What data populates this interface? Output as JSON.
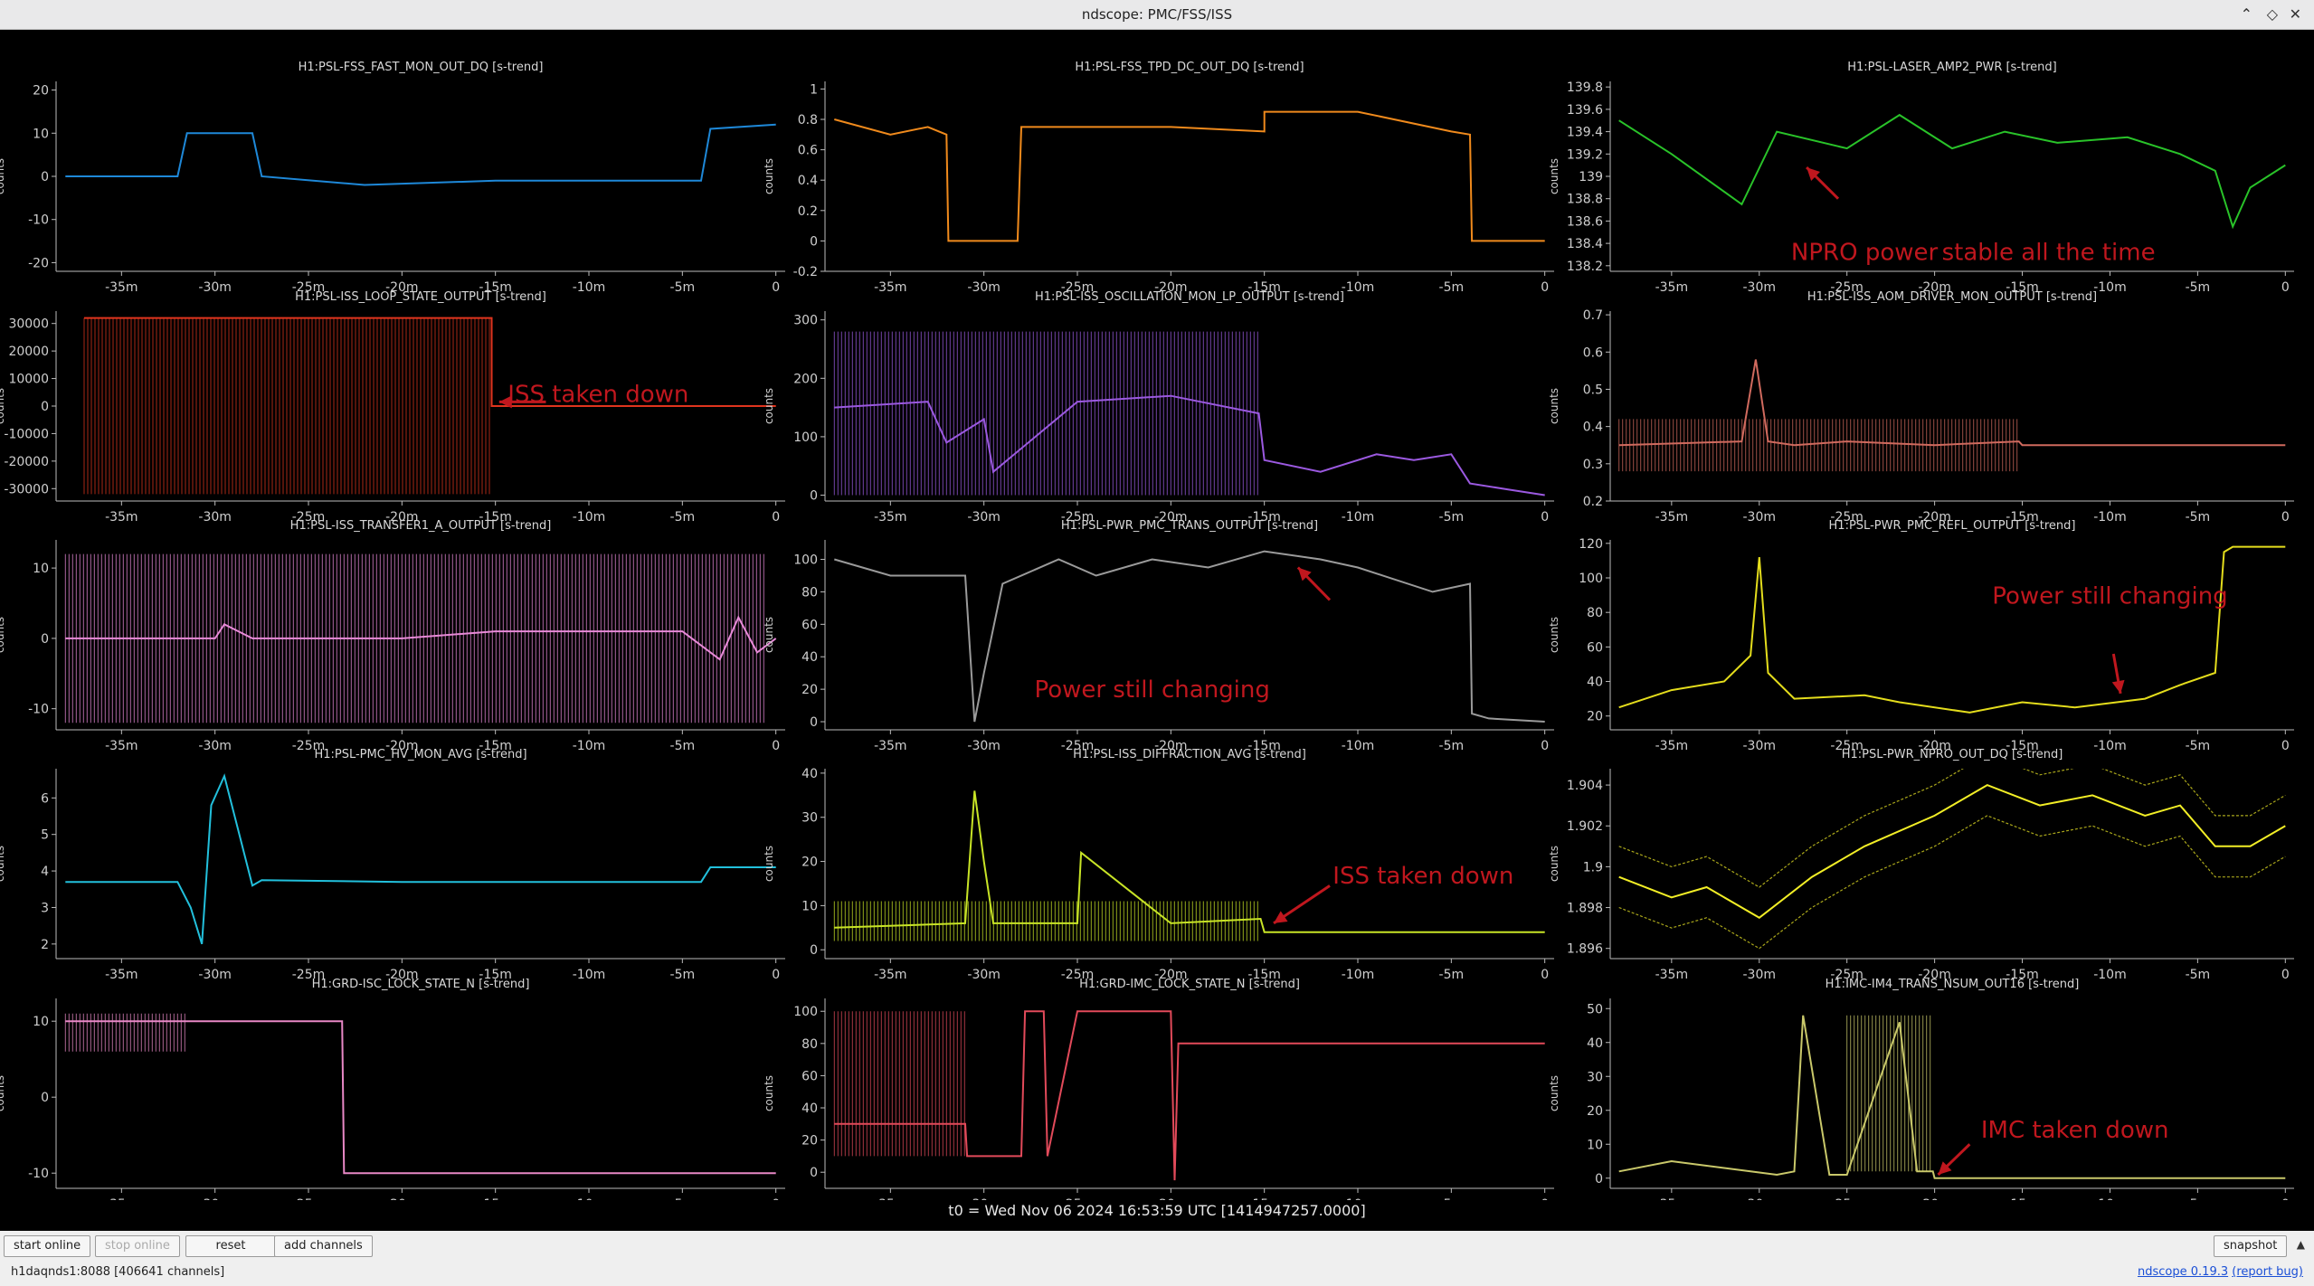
{
  "window": {
    "title": "ndscope: PMC/FSS/ISS"
  },
  "footer": {
    "t0_label": "t0 = Wed Nov 06 2024 16:53:59 UTC [1414947257.0000]",
    "start_online": "start online",
    "stop_online": "stop online",
    "reset": "reset",
    "add_channels": "add channels",
    "snapshot": "snapshot",
    "status": "h1daqnds1:8088  [406641 channels]",
    "version": "ndscope 0.19.3",
    "report_bug": "(report bug)"
  },
  "colors": {
    "annotation": "#c0171e",
    "background": "#000000",
    "axis": "#bbbbbb"
  },
  "chart_data": [
    {
      "type": "line",
      "title": "H1:PSL-FSS_FAST_MON_OUT_DQ [s-trend]",
      "ylabel": "counts",
      "color": "#1e88d8",
      "ylim": [
        -22,
        22
      ],
      "yticks": [
        -20,
        -10,
        0,
        10,
        20
      ],
      "x": [
        -38,
        -32,
        -31.5,
        -28,
        -27.5,
        -22,
        -15,
        -10,
        -4,
        -3.5,
        0
      ],
      "y": [
        0,
        0,
        10,
        10,
        0,
        -2,
        -1,
        -1,
        -1,
        11,
        12
      ],
      "annotations": []
    },
    {
      "type": "line",
      "title": "H1:PSL-FSS_TPD_DC_OUT_DQ [s-trend]",
      "ylabel": "counts",
      "color": "#f08a1c",
      "ylim": [
        -0.2,
        1.05
      ],
      "yticks": [
        -0.2,
        0,
        0.2,
        0.4,
        0.6,
        0.8,
        1
      ],
      "x": [
        -38,
        -35,
        -33,
        -32,
        -31.9,
        -28.2,
        -28,
        -25,
        -20,
        -15,
        -15,
        -10,
        -5,
        -4,
        -3.9,
        0
      ],
      "y": [
        0.8,
        0.7,
        0.75,
        0.7,
        0,
        0,
        0.75,
        0.75,
        0.75,
        0.72,
        0.85,
        0.85,
        0.72,
        0.7,
        0,
        0
      ],
      "annotations": []
    },
    {
      "type": "line",
      "title": "H1:PSL-LASER_AMP2_PWR [s-trend]",
      "ylabel": "counts",
      "color": "#29c329",
      "ylim": [
        138.15,
        139.85
      ],
      "yticks": [
        138.2,
        138.4,
        138.6,
        138.8,
        139,
        139.2,
        139.4,
        139.6,
        139.8
      ],
      "x": [
        -38,
        -35,
        -31,
        -29,
        -25,
        -22,
        -19,
        -16,
        -13,
        -9,
        -6,
        -4,
        -3,
        -2,
        0
      ],
      "y": [
        139.5,
        139.2,
        138.75,
        139.4,
        139.25,
        139.55,
        139.25,
        139.4,
        139.3,
        139.35,
        139.2,
        139.05,
        138.55,
        138.9,
        139.1
      ],
      "annotations": [
        {
          "text": "NPRO power",
          "x": -24,
          "y": 138.25
        },
        {
          "text": "stable all the time",
          "x": -13.5,
          "y": 138.25
        }
      ],
      "arrows": [
        {
          "x1": -25.5,
          "y1": 138.8,
          "x2": -27.3,
          "y2": 139.08
        }
      ]
    },
    {
      "type": "line",
      "title": "H1:PSL-ISS_LOOP_STATE_OUTPUT [s-trend]",
      "ylabel": "counts",
      "color": "#e0341e",
      "ylim": [
        -34500,
        34500
      ],
      "yticks": [
        -30000,
        -20000,
        -10000,
        0,
        10000,
        20000,
        30000
      ],
      "x": [
        -37,
        -15.2,
        -15.2,
        0
      ],
      "y": [
        32000,
        32000,
        0,
        0
      ],
      "band": [
        -37,
        -15.2,
        -32000,
        32000
      ],
      "annotations": [
        {
          "text": "ISS taken down",
          "x": -9.5,
          "y": 1500
        }
      ],
      "arrows": [
        {
          "x1": -12.3,
          "y1": 1500,
          "x2": -14.8,
          "y2": 1500
        }
      ]
    },
    {
      "type": "line",
      "title": "H1:PSL-ISS_OSCILLATION_MON_LP_OUTPUT [s-trend]",
      "ylabel": "counts",
      "color": "#9b59e0",
      "ylim": [
        -10,
        315
      ],
      "yticks": [
        0,
        100,
        200,
        300
      ],
      "x": [
        -38,
        -33,
        -32,
        -30,
        -29.5,
        -25,
        -20,
        -15.3,
        -15,
        -12,
        -9,
        -7,
        -5,
        -4,
        -2,
        0
      ],
      "y": [
        150,
        160,
        90,
        130,
        40,
        160,
        170,
        140,
        60,
        40,
        70,
        60,
        70,
        20,
        10,
        0
      ],
      "band": [
        -38,
        -15.3,
        0,
        280
      ],
      "annotations": []
    },
    {
      "type": "line",
      "title": "H1:PSL-ISS_AOM_DRIVER_MON_OUTPUT [s-trend]",
      "ylabel": "counts",
      "color": "#d06a5e",
      "ylim": [
        0.2,
        0.71
      ],
      "yticks": [
        0.2,
        0.3,
        0.4,
        0.5,
        0.6,
        0.7
      ],
      "x": [
        -38,
        -31,
        -30.2,
        -29.5,
        -28,
        -25,
        -20,
        -15.2,
        -15,
        0
      ],
      "y": [
        0.35,
        0.36,
        0.58,
        0.36,
        0.35,
        0.36,
        0.35,
        0.36,
        0.35,
        0.35
      ],
      "band": [
        -38,
        -15.2,
        0.28,
        0.42
      ],
      "annotations": []
    },
    {
      "type": "line",
      "title": "H1:PSL-ISS_TRANSFER1_A_OUTPUT [s-trend]",
      "ylabel": "counts",
      "color": "#e88ad8",
      "ylim": [
        -13,
        14
      ],
      "yticks": [
        -10,
        0,
        10
      ],
      "x": [
        -38,
        -30,
        -29.5,
        -28,
        -20,
        -15,
        -10,
        -5,
        -3,
        -2,
        -1,
        0
      ],
      "y": [
        0,
        0,
        2,
        0,
        0,
        1,
        1,
        1,
        -3,
        3,
        -2,
        0
      ],
      "band": [
        -38,
        -0.5,
        -12,
        12
      ],
      "annotations": []
    },
    {
      "type": "line",
      "title": "H1:PSL-PWR_PMC_TRANS_OUTPUT [s-trend]",
      "ylabel": "counts",
      "color": "#9a9a9a",
      "ylim": [
        -5,
        112
      ],
      "yticks": [
        0,
        20,
        40,
        60,
        80,
        100
      ],
      "x": [
        -38,
        -35,
        -31,
        -30.5,
        -30,
        -29,
        -26,
        -24,
        -21,
        -18,
        -15,
        -12,
        -10,
        -6,
        -4,
        -3.9,
        -3,
        0
      ],
      "y": [
        100,
        90,
        90,
        0,
        30,
        85,
        100,
        90,
        100,
        95,
        105,
        100,
        95,
        80,
        85,
        5,
        2,
        0
      ],
      "annotations": [
        {
          "text": "Power still changing",
          "x": -21,
          "y": 15
        }
      ],
      "arrows": [
        {
          "x1": -11.5,
          "y1": 75,
          "x2": -13.2,
          "y2": 95
        }
      ]
    },
    {
      "type": "line",
      "title": "H1:PSL-PWR_PMC_REFL_OUTPUT [s-trend]",
      "ylabel": "counts",
      "color": "#e4dd1c",
      "ylim": [
        12,
        122
      ],
      "yticks": [
        20,
        40,
        60,
        80,
        100,
        120
      ],
      "x": [
        -38,
        -35,
        -32,
        -30.5,
        -30,
        -29.5,
        -28,
        -24,
        -22,
        -18,
        -15,
        -12,
        -8,
        -6,
        -4,
        -3.5,
        -3,
        0
      ],
      "y": [
        25,
        35,
        40,
        55,
        112,
        45,
        30,
        32,
        28,
        22,
        28,
        25,
        30,
        38,
        45,
        115,
        118,
        118
      ],
      "annotations": [
        {
          "text": "Power still changing",
          "x": -10,
          "y": 85
        }
      ],
      "arrows": [
        {
          "x1": -9.8,
          "y1": 56,
          "x2": -9.4,
          "y2": 33
        }
      ]
    },
    {
      "type": "line",
      "title": "H1:PSL-PMC_HV_MON_AVG [s-trend]",
      "ylabel": "counts",
      "color": "#22c0dc",
      "ylim": [
        1.6,
        6.8
      ],
      "yticks": [
        2,
        3,
        4,
        5,
        6
      ],
      "x": [
        -38,
        -32,
        -31.3,
        -30.7,
        -30.2,
        -29.5,
        -28.8,
        -28,
        -27.5,
        -20,
        -10,
        -4,
        -3.5,
        0
      ],
      "y": [
        3.7,
        3.7,
        3.0,
        2.0,
        5.8,
        6.6,
        5.2,
        3.6,
        3.75,
        3.7,
        3.7,
        3.7,
        4.1,
        4.1
      ],
      "annotations": []
    },
    {
      "type": "line",
      "title": "H1:PSL-ISS_DIFFRACTION_AVG [s-trend]",
      "ylabel": "counts",
      "color": "#c8e426",
      "ylim": [
        -2,
        41
      ],
      "yticks": [
        0,
        10,
        20,
        30,
        40
      ],
      "x": [
        -38,
        -31,
        -30.5,
        -30,
        -29.5,
        -25,
        -24.8,
        -20,
        -15.2,
        -15,
        0
      ],
      "y": [
        5,
        6,
        36,
        20,
        6,
        6,
        22,
        6,
        7,
        4,
        4
      ],
      "band": [
        -38,
        -15.2,
        2,
        11
      ],
      "annotations": [
        {
          "text": "ISS taken down",
          "x": -6.5,
          "y": 15
        }
      ],
      "arrows": [
        {
          "x1": -11.5,
          "y1": 14.5,
          "x2": -14.5,
          "y2": 6
        }
      ]
    },
    {
      "type": "line",
      "title": "H1:PSL-PWR_NPRO_OUT_DQ [s-trend]",
      "ylabel": "counts",
      "color": "#f2ee26",
      "ylim": [
        1.8955,
        1.9048
      ],
      "yticks": [
        1.896,
        1.898,
        1.9,
        1.902,
        1.904
      ],
      "x": [
        -38,
        -35,
        -33,
        -30,
        -27,
        -24,
        -20,
        -17,
        -14,
        -11,
        -8,
        -6,
        -4,
        -2,
        0
      ],
      "y": [
        1.8995,
        1.8985,
        1.899,
        1.8975,
        1.8995,
        1.901,
        1.9025,
        1.904,
        1.903,
        1.9035,
        1.9025,
        1.903,
        1.901,
        1.901,
        1.902
      ],
      "band_width": 0.0015,
      "annotations": []
    },
    {
      "type": "line",
      "title": "H1:GRD-ISC_LOCK_STATE_N [s-trend]",
      "ylabel": "counts",
      "color": "#e888c6",
      "ylim": [
        -12,
        13
      ],
      "yticks": [
        -10,
        0,
        10
      ],
      "x": [
        -38,
        -31.5,
        -30.5,
        -23.2,
        -23.1,
        0
      ],
      "y": [
        10,
        10,
        10,
        10,
        -10,
        -10
      ],
      "band": [
        -38,
        -31.5,
        6,
        11
      ],
      "annotations": []
    },
    {
      "type": "line",
      "title": "H1:GRD-IMC_LOCK_STATE_N [s-trend]",
      "ylabel": "counts",
      "color": "#e24a5a",
      "ylim": [
        -10,
        108
      ],
      "yticks": [
        0,
        20,
        40,
        60,
        80,
        100
      ],
      "x": [
        -38,
        -31,
        -30.9,
        -28,
        -27.8,
        -26.8,
        -26.6,
        -25,
        -24.7,
        -20,
        -19.8,
        -19.6,
        0
      ],
      "y": [
        30,
        30,
        10,
        10,
        100,
        100,
        10,
        100,
        100,
        100,
        -5,
        80,
        80
      ],
      "band": [
        -38,
        -31,
        10,
        100
      ],
      "annotations": []
    },
    {
      "type": "line",
      "title": "H1:IMC-IM4_TRANS_NSUM_OUT16 [s-trend]",
      "ylabel": "counts",
      "color": "#c9c86a",
      "ylim": [
        -3,
        53
      ],
      "yticks": [
        0,
        10,
        20,
        30,
        40,
        50
      ],
      "x": [
        -38,
        -35,
        -32,
        -29,
        -28,
        -27.5,
        -26,
        -25,
        -22,
        -21,
        -20.1,
        -20,
        0
      ],
      "y": [
        2,
        5,
        3,
        1,
        2,
        48,
        1,
        1,
        46,
        2,
        2,
        0,
        0
      ],
      "band": [
        -25,
        -20.1,
        2,
        48
      ],
      "annotations": [
        {
          "text": "IMC taken down",
          "x": -12,
          "y": 12
        }
      ],
      "arrows": [
        {
          "x1": -18,
          "y1": 10,
          "x2": -19.8,
          "y2": 1
        }
      ]
    }
  ]
}
